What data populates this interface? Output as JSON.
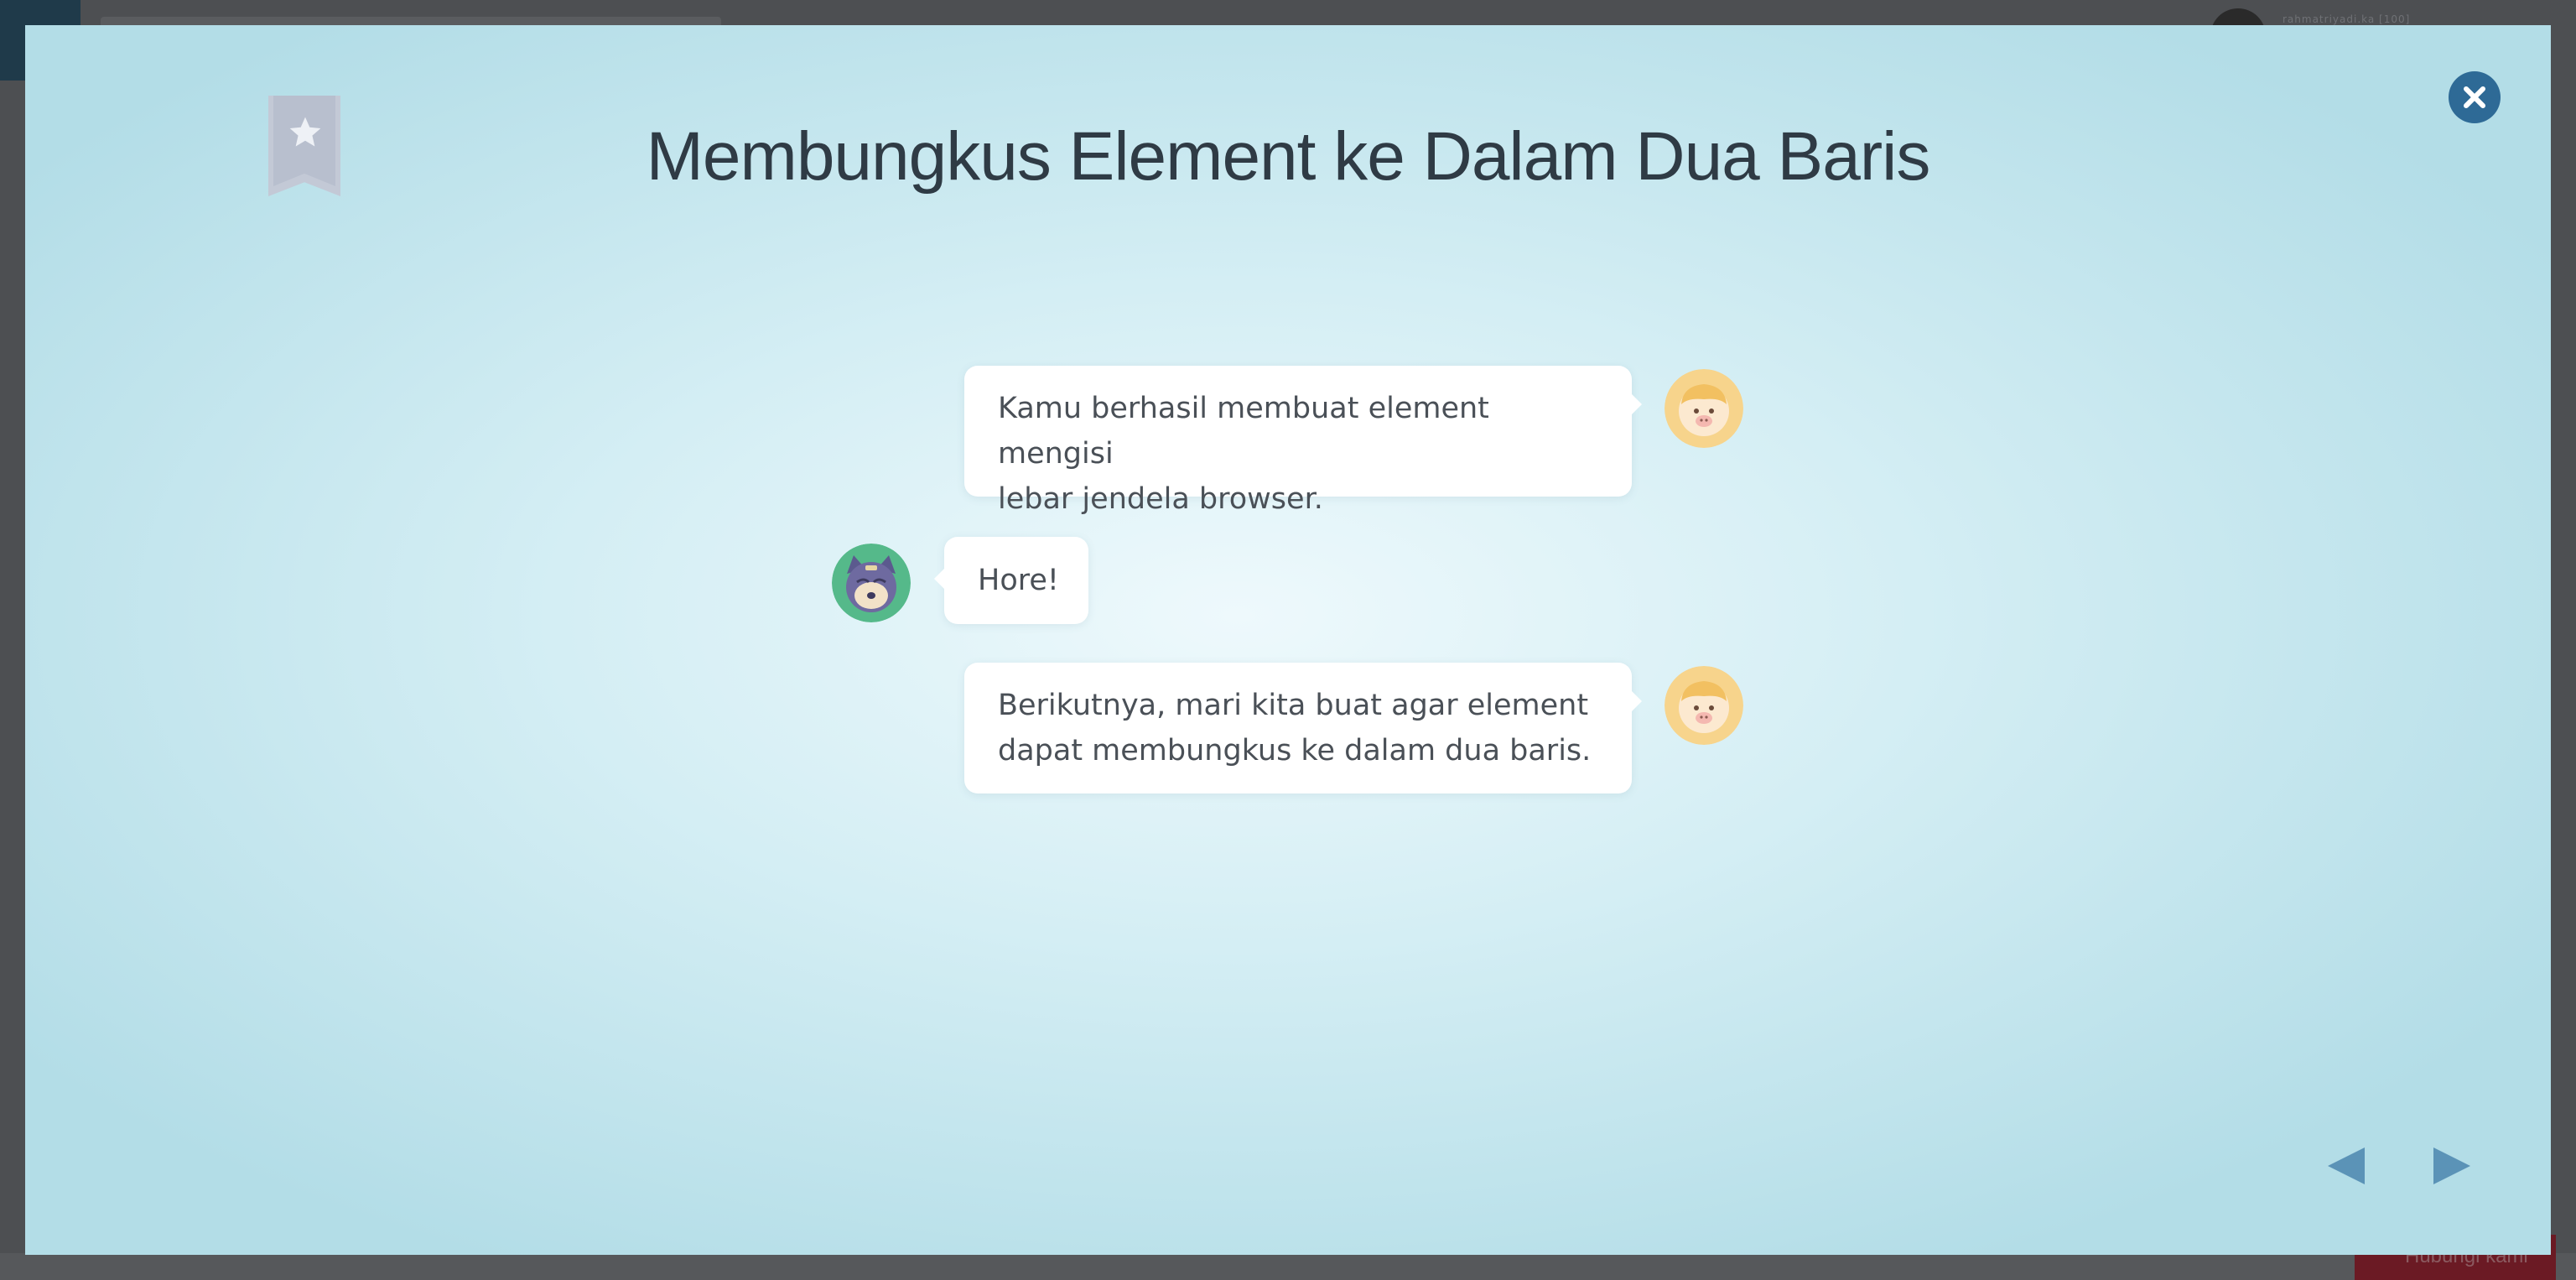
{
  "background": {
    "username": "rahmatriyadi.ka [100]",
    "hint_button": "Hubungi kami"
  },
  "lesson": {
    "title": "Membungkus Element ke Dalam Dua Baris"
  },
  "dialog": [
    {
      "speaker": "sheep",
      "side": "right",
      "lines": [
        "Kamu berhasil membuat element mengisi",
        "lebar jendela browser."
      ]
    },
    {
      "speaker": "cat",
      "side": "left",
      "lines": [
        "Hore!"
      ]
    },
    {
      "speaker": "sheep",
      "side": "right",
      "lines": [
        "Berikutnya, mari kita buat agar element",
        "dapat membungkus ke dalam dua baris."
      ]
    }
  ],
  "icons": {
    "bookmark": "bookmark-star-icon",
    "close": "close-icon",
    "prev": "triangle-left-icon",
    "next": "triangle-right-icon"
  },
  "colors": {
    "accent": "#2e6a96",
    "arrow": "#5b93b7",
    "title": "#2f3b45",
    "bubble_text": "#4a5057"
  }
}
